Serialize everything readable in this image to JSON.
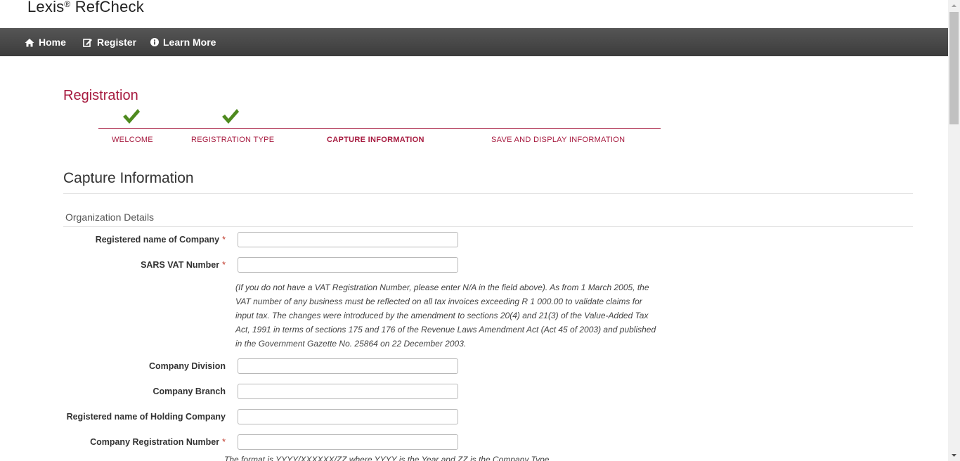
{
  "header": {
    "logo_main": "Lexis",
    "logo_reg": "®",
    "logo_product": " RefCheck"
  },
  "nav": {
    "items": [
      {
        "label": "Home",
        "icon": "home-icon"
      },
      {
        "label": "Register",
        "icon": "edit-icon"
      },
      {
        "label": "Learn More",
        "icon": "info-icon"
      }
    ]
  },
  "registration": {
    "title": "Registration",
    "steps": [
      {
        "label": "WELCOME",
        "completed": true
      },
      {
        "label": "REGISTRATION TYPE",
        "completed": true
      },
      {
        "label": "CAPTURE INFORMATION",
        "completed": false,
        "active": true
      },
      {
        "label": "SAVE AND DISPLAY INFORMATION",
        "completed": false
      }
    ]
  },
  "capture": {
    "title": "Capture Information",
    "section": "Organization Details",
    "required_marker": "*",
    "fields": [
      {
        "label": "Registered name of Company",
        "required": true,
        "value": ""
      },
      {
        "label": "SARS VAT Number",
        "required": true,
        "value": ""
      },
      {
        "label": "Company Division",
        "required": false,
        "value": ""
      },
      {
        "label": "Company Branch",
        "required": false,
        "value": ""
      },
      {
        "label": "Registered name of Holding Company",
        "required": false,
        "value": ""
      },
      {
        "label": "Company Registration Number",
        "required": true,
        "value": ""
      }
    ],
    "vat_note": "(If you do not have a VAT Registration Number, please enter N/A in the field above). As from 1 March 2005, the VAT number of any business must be reflected on all tax invoices exceeding R 1 000.00 to validate claims for input tax. The changes were introduced by the amendment to sections 20(4) and 21(3) of the Value-Added Tax Act, 1991 in terms of sections 175 and 176 of the Revenue Laws Amendment Act (Act 45 of 2003) and published in the Government Gazette No. 25864 on 22 December 2003.",
    "format_note": "The format is YYYY/XXXXXX/ZZ where YYYY is the Year and ZZ is the Company Type"
  },
  "colors": {
    "brand": "#a6193e",
    "check": "#4e8a1e",
    "navbar": "#444444"
  }
}
